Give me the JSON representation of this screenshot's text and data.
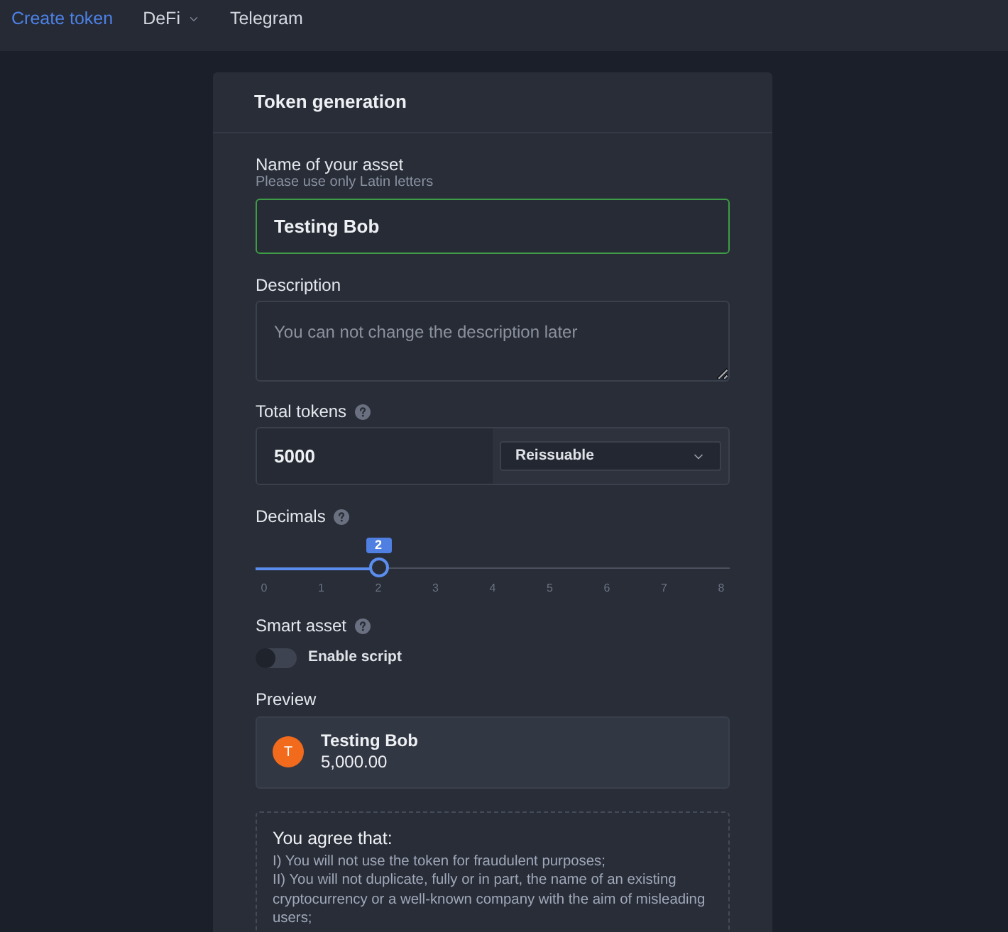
{
  "nav": {
    "items": [
      {
        "label": "Create token",
        "selected": true,
        "dropdown": false
      },
      {
        "label": "DeFi",
        "selected": false,
        "dropdown": true
      },
      {
        "label": "Telegram",
        "selected": false,
        "dropdown": false
      }
    ]
  },
  "card": {
    "title": "Token generation"
  },
  "name_field": {
    "label": "Name of your asset",
    "hint": "Please use only Latin letters",
    "value": "Testing Bob",
    "valid": true
  },
  "description_field": {
    "label": "Description",
    "placeholder": "You can not change the description later"
  },
  "total_tokens": {
    "label": "Total tokens",
    "help": true,
    "value": "5000",
    "select": "Reissuable"
  },
  "decimals": {
    "label": "Decimals",
    "help": true,
    "value": "2",
    "level": 0.25,
    "ticks": [
      "0",
      "1",
      "2",
      "3",
      "4",
      "5",
      "6",
      "7",
      "8"
    ]
  },
  "smart_asset": {
    "label": "Smart asset",
    "help": true,
    "toggle_label": "Enable script",
    "on": false
  },
  "preview": {
    "label": "Preview",
    "avatar": "T",
    "name": "Testing Bob",
    "amount": "5,000.00"
  },
  "agreement": {
    "title": "You agree that:",
    "items": [
      "I) You will not use the token for fraudulent purposes;",
      "II) You will not duplicate, fully or in part, the name of an existing cryptocurrency or a well-known company with the aim of misleading users;"
    ]
  }
}
